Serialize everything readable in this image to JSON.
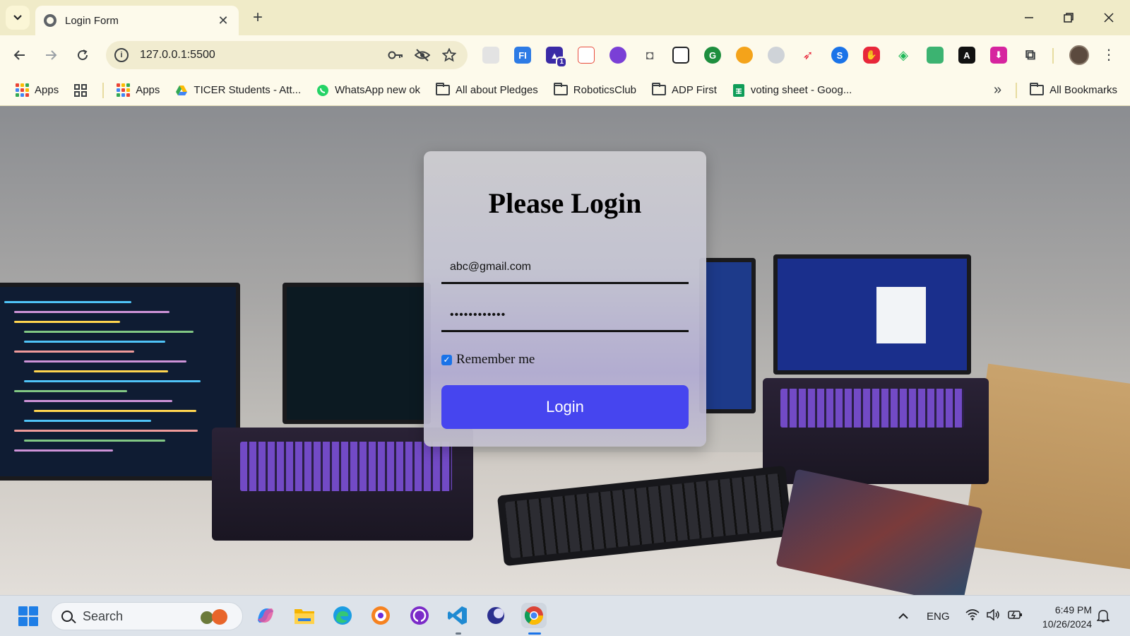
{
  "browser": {
    "tab_title": "Login Form",
    "tab_close": "✕",
    "new_tab": "+",
    "url": "127.0.0.1:5500",
    "window": {
      "minimize": "—",
      "restore": "❐",
      "close": "✕"
    }
  },
  "bookmarks": {
    "items": [
      {
        "label": "Apps",
        "icon": "apps-grid-icon"
      },
      {
        "label": "Apps",
        "icon": "apps-grid-icon"
      },
      {
        "label": "TICER Students - Att...",
        "icon": "google-drive-icon"
      },
      {
        "label": "WhatsApp new ok",
        "icon": "whatsapp-icon"
      },
      {
        "label": "All about Pledges",
        "icon": "folder-icon"
      },
      {
        "label": "RoboticsClub",
        "icon": "folder-icon"
      },
      {
        "label": "ADP First",
        "icon": "folder-icon"
      },
      {
        "label": "voting sheet - Goog...",
        "icon": "google-sheets-icon"
      }
    ],
    "overflow": "»",
    "all_bookmarks": "All Bookmarks"
  },
  "extensions": {
    "badge_count": "1",
    "colors": [
      "#d9d9d9",
      "#2d7be5",
      "#3a2aa6",
      "#e84d3d",
      "#7a3fd6",
      "#6b6b6b",
      "#202124",
      "#1e8e3e",
      "#f4a31a",
      "#cfd3d8",
      "#e8273a",
      "#1a73e8",
      "#e8273a",
      "#1eb858",
      "#3cb371",
      "#111111",
      "#d6249f"
    ]
  },
  "login": {
    "title": "Please Login",
    "email_value": "abc@gmail.com",
    "password_value": "••••••••••••",
    "remember_label": "Remember me",
    "remember_checked": true,
    "button_label": "Login",
    "button_color": "#4645ef"
  },
  "taskbar": {
    "search_placeholder": "Search",
    "language": "ENG",
    "time": "6:49 PM",
    "date": "10/26/2024",
    "apps": [
      "copilot-icon",
      "file-explorer-icon",
      "edge-icon",
      "brave-icon",
      "github-icon",
      "vscode-icon",
      "arc-icon",
      "chrome-icon"
    ]
  }
}
